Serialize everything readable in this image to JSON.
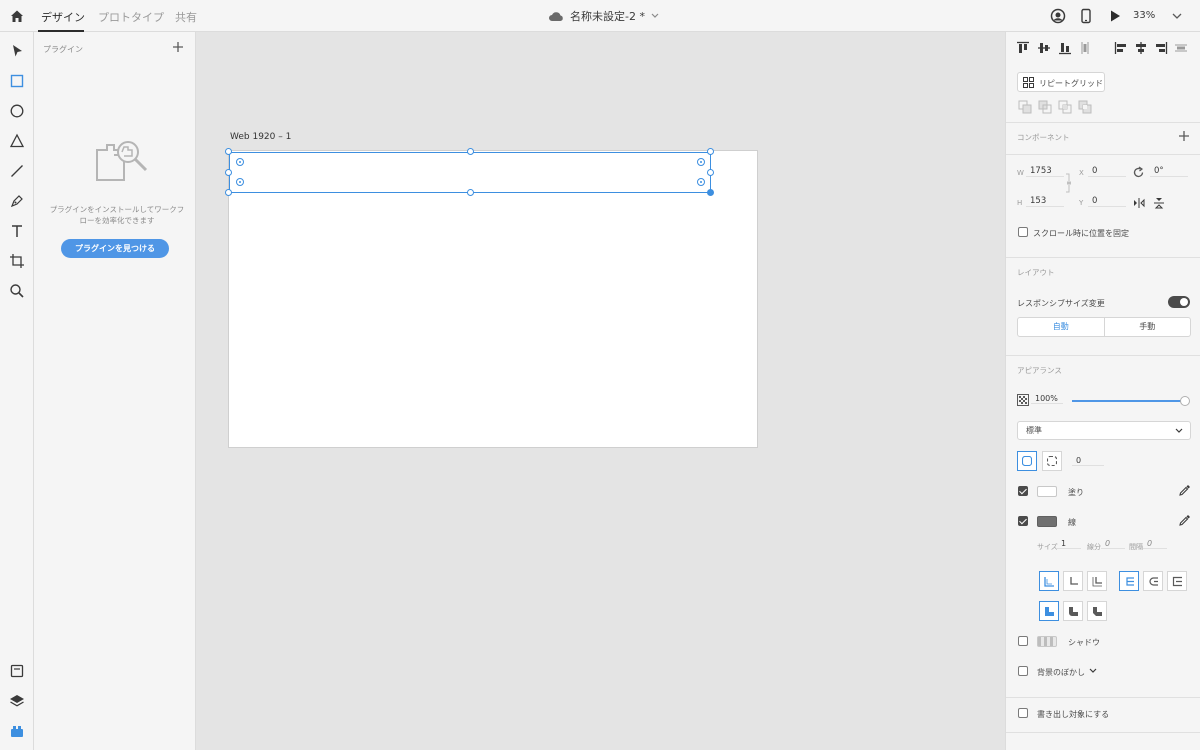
{
  "topbar": {
    "tabs": [
      {
        "label": "デザイン",
        "active": true
      },
      {
        "label": "プロトタイプ",
        "active": false
      },
      {
        "label": "共有",
        "active": false
      }
    ],
    "document_title": "名称未設定-2 *",
    "zoom": "33%"
  },
  "plugins": {
    "title": "プラグイン",
    "description_line1": "プラグインをインストールしてワークフ",
    "description_line2": "ローを効率化できます",
    "find_button": "プラグインを見つける"
  },
  "canvas": {
    "artboard_label": "Web 1920 – 1"
  },
  "props": {
    "repeat_grid": "リピートグリッド",
    "component_title": "コンポーネント",
    "w_label": "W",
    "w_value": "1753",
    "h_label": "H",
    "h_value": "153",
    "x_label": "X",
    "x_value": "0",
    "y_label": "Y",
    "y_value": "0",
    "rotation": "0°",
    "fix_scroll": "スクロール時に位置を固定",
    "layout_title": "レイアウト",
    "responsive_resize": "レスポンシブサイズ変更",
    "responsive_on": true,
    "seg_auto": "自動",
    "seg_manual": "手動",
    "appearance_title": "アピアランス",
    "opacity": "100%",
    "opacity_fraction": 1.0,
    "blend_mode": "標準",
    "corner_value": "0",
    "fill_label": "塗り",
    "fill_checked": true,
    "stroke_label": "線",
    "stroke_checked": true,
    "stroke_size_label": "サイズ",
    "stroke_size_value": "1",
    "dash_label": "線分",
    "dash_value": "0",
    "gap_label": "間隔",
    "gap_value": "0",
    "shadow_label": "シャドウ",
    "shadow_checked": false,
    "bg_blur_label": "背景のぼかし",
    "bg_blur_checked": false,
    "export_label": "書き出し対象にする",
    "export_checked": false
  },
  "colors": {
    "accent": "#4f96e6",
    "selection": "#3d8fe0"
  }
}
